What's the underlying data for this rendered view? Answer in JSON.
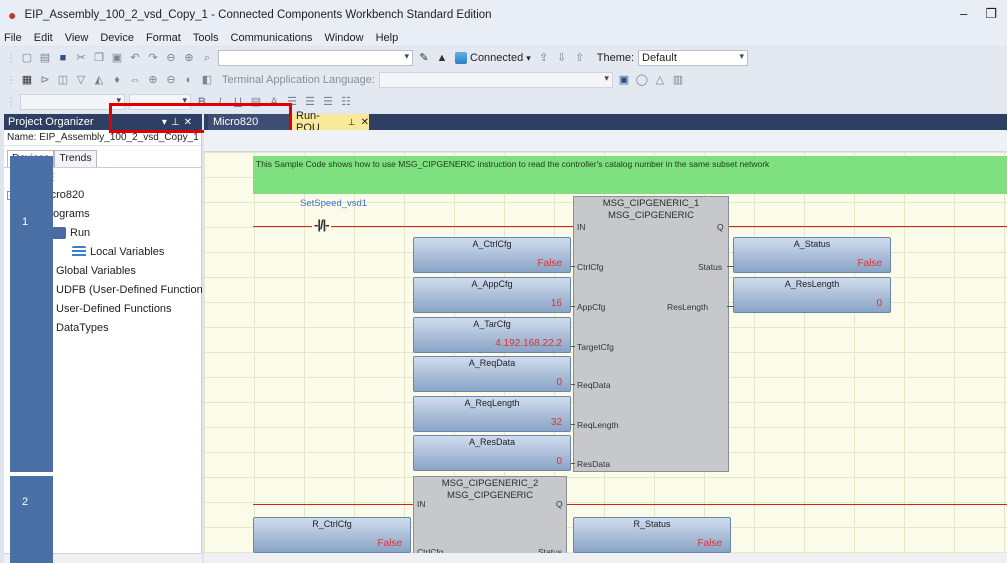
{
  "window": {
    "title": "EIP_Assembly_100_2_vsd_Copy_1 - Connected Components Workbench Standard Edition"
  },
  "menu": [
    "File",
    "Edit",
    "View",
    "Device",
    "Format",
    "Tools",
    "Communications",
    "Window",
    "Help"
  ],
  "toolbar": {
    "connected_label": "Connected",
    "theme_label": "Theme:",
    "theme_value": "Default",
    "terminal_label": "Terminal Application Language:"
  },
  "project_organizer": {
    "title": "Project Organizer",
    "name_label": "Name:",
    "name_value": "EIP_Assembly_100_2_vsd_Copy_1",
    "tabs": [
      "Devices",
      "Trends"
    ],
    "tree": [
      {
        "label": "Micro820"
      },
      {
        "label": "Programs"
      },
      {
        "label": "Run"
      },
      {
        "label": "Local Variables"
      },
      {
        "label": "Global Variables"
      },
      {
        "label": "UDFB (User-Defined Function"
      },
      {
        "label": "User-Defined Functions"
      },
      {
        "label": "DataTypes"
      }
    ]
  },
  "editor_tabs": [
    {
      "label": "Micro820"
    },
    {
      "label": "Run-POU"
    }
  ],
  "rung1": {
    "number": "1",
    "comment": "This Sample Code shows how to use MSG_CIPGENERIC instruction to read the controller's catalog number in the same subset network",
    "contact_label": "SetSpeed_vsd1",
    "contact_symbol": "-|/|-",
    "block": {
      "instance": "MSG_CIPGENERIC_1",
      "type": "MSG_CIPGENERIC",
      "in_pins": [
        "IN",
        "CtrlCfg",
        "AppCfg",
        "TargetCfg",
        "ReqData",
        "ReqLength",
        "ResData"
      ],
      "out_pins": [
        "Q",
        "Status",
        "ResLength"
      ]
    },
    "inputs": [
      {
        "name": "A_CtrlCfg",
        "value": "False"
      },
      {
        "name": "A_AppCfg",
        "value": "16"
      },
      {
        "name": "A_TarCfg",
        "value": "4.192.168.22.2"
      },
      {
        "name": "A_ReqData",
        "value": "0"
      },
      {
        "name": "A_ReqLength",
        "value": "32"
      },
      {
        "name": "A_ResData",
        "value": "0"
      }
    ],
    "outputs": [
      {
        "name": "A_Status",
        "value": "False"
      },
      {
        "name": "A_ResLength",
        "value": "0"
      }
    ]
  },
  "rung2": {
    "number": "2",
    "block": {
      "instance": "MSG_CIPGENERIC_2",
      "type": "MSG_CIPGENERIC",
      "in_pins": [
        "IN",
        "CtrlCfg"
      ],
      "out_pins": [
        "Q",
        "Status"
      ]
    },
    "inputs": [
      {
        "name": "R_CtrlCfg",
        "value": "False"
      }
    ],
    "outputs": [
      {
        "name": "R_Status",
        "value": "False"
      }
    ]
  }
}
